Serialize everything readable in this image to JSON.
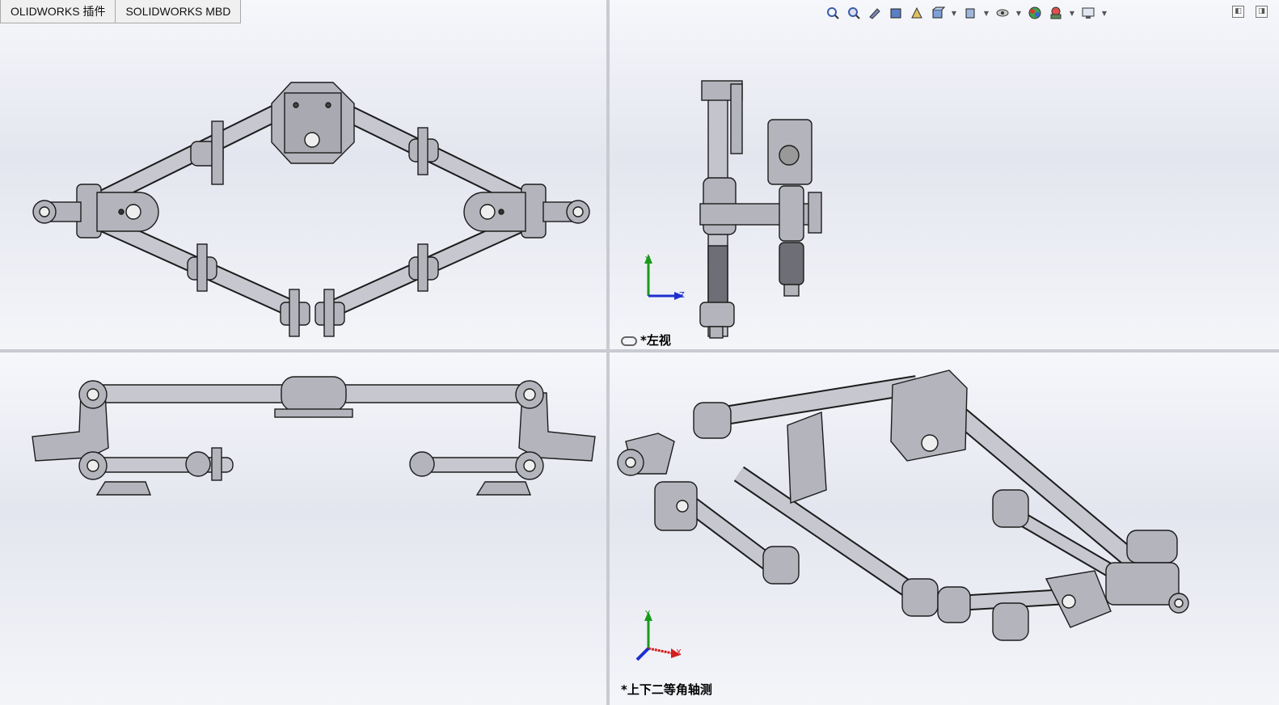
{
  "command_manager": {
    "tabs": [
      "OLIDWORKS 插件",
      "SOLIDWORKS MBD"
    ]
  },
  "heads_up_toolbar": {
    "icons": [
      "zoom-to-fit-icon",
      "zoom-to-area-icon",
      "previous-view-icon",
      "section-view-icon",
      "dynamic-annotation-icon",
      "view-orientation-icon",
      "display-style-icon",
      "hide-show-items-icon",
      "edit-appearance-icon",
      "apply-scene-icon",
      "view-settings-icon"
    ]
  },
  "viewports": {
    "top": {
      "orientation": "top"
    },
    "left": {
      "label": "*左视",
      "axes": [
        "Y",
        "Z"
      ]
    },
    "front": {
      "orientation": "front"
    },
    "iso": {
      "label": "*上下二等角轴测",
      "axes": [
        "Y",
        "X"
      ]
    }
  },
  "colors": {
    "part_fill": "#b4b4bc",
    "part_edge": "#1c1c1c",
    "axis_y": "#1a9a1a",
    "axis_z": "#1d2fd0",
    "axis_x": "#d21f1f",
    "background": "#eceef4"
  }
}
